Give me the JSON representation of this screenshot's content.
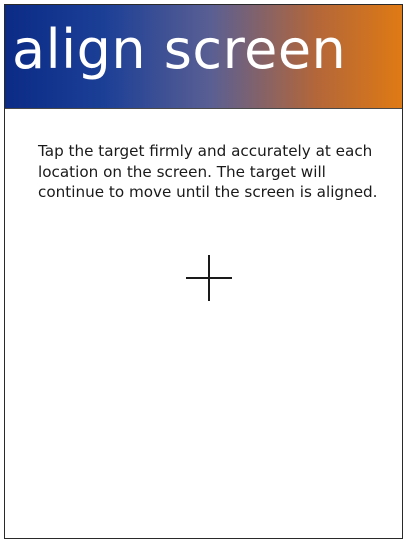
{
  "header": {
    "title": "align screen",
    "gradient_start_color": "#0b2b86",
    "gradient_end_color": "#df7a14"
  },
  "body": {
    "instructions": "Tap the target firmly and accurately at each location on the screen. The target will continue to move until the screen is aligned."
  },
  "target": {
    "icon": "crosshair-icon"
  }
}
